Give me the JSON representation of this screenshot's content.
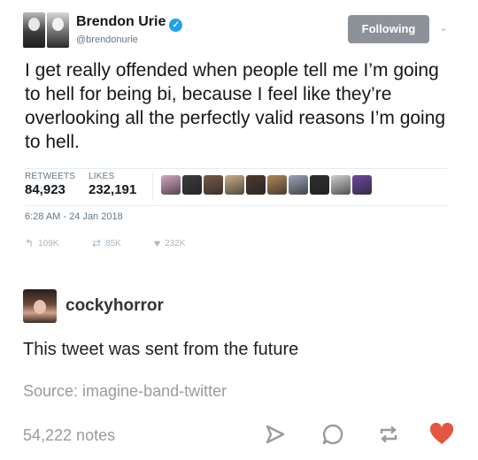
{
  "tweet": {
    "display_name": "Brendon Urie",
    "handle": "@brendonurie",
    "follow_label": "Following",
    "text": "I get really offended when people tell me I’m going to hell for being bi, because I feel like they’re overlooking all the perfectly valid reasons I’m going to hell.",
    "retweets_label": "RETWEETS",
    "retweets_value": "84,923",
    "likes_label": "LIKES",
    "likes_value": "232,191",
    "timestamp": "6:28 AM - 24 Jan 2018",
    "reply_count": "109K",
    "retweet_count": "85K",
    "like_count": "232K",
    "liker_avatar_colors": [
      "#d6a7c4",
      "#3b3b3b",
      "#7a5a4a",
      "#c9b089",
      "#4b3a2e",
      "#b08858",
      "#9aa4b4",
      "#2e2e2e",
      "#cfcfcf",
      "#6b4aa0"
    ]
  },
  "reblog": {
    "username": "cockyhorror",
    "text": "This tweet was sent from the future",
    "source": "Source: imagine-band-twitter"
  },
  "footer": {
    "notes": "54,222 notes",
    "like_color": "#e65541"
  }
}
